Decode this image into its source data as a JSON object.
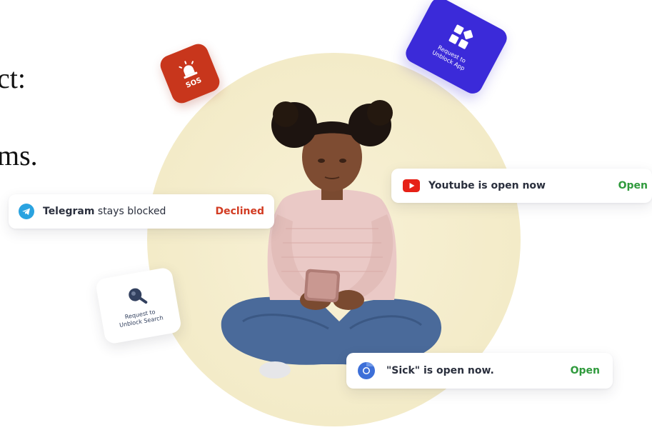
{
  "left_text": {
    "line1": "ct:",
    "line2": "ms."
  },
  "hero": {
    "illustration": "child-using-phone"
  },
  "tiles": {
    "sos": {
      "label": "SOS",
      "icon": "siren-icon",
      "color": "#c8361c"
    },
    "unblock_app": {
      "caption_line1": "Request to",
      "caption_line2": "Unblock App",
      "icon": "app-grid-icon",
      "color": "#3b2ad9"
    },
    "unblock_search": {
      "caption_line1": "Request to",
      "caption_line2": "Unblock Search",
      "icon": "search-icon",
      "color": "#33415f"
    }
  },
  "notifications": {
    "youtube": {
      "text": "Youtube is open now",
      "status": "Open",
      "status_color": "#2f9a3c",
      "icon": "youtube-icon"
    },
    "telegram": {
      "app_name": "Telegram",
      "text_rest": " stays blocked",
      "status": "Declined",
      "status_color": "#d23b22",
      "icon": "telegram-icon"
    },
    "sick": {
      "text": "\"Sick\" is open now.",
      "status": "Open",
      "status_color": "#2f9a3c",
      "icon": "chrome-icon"
    }
  }
}
